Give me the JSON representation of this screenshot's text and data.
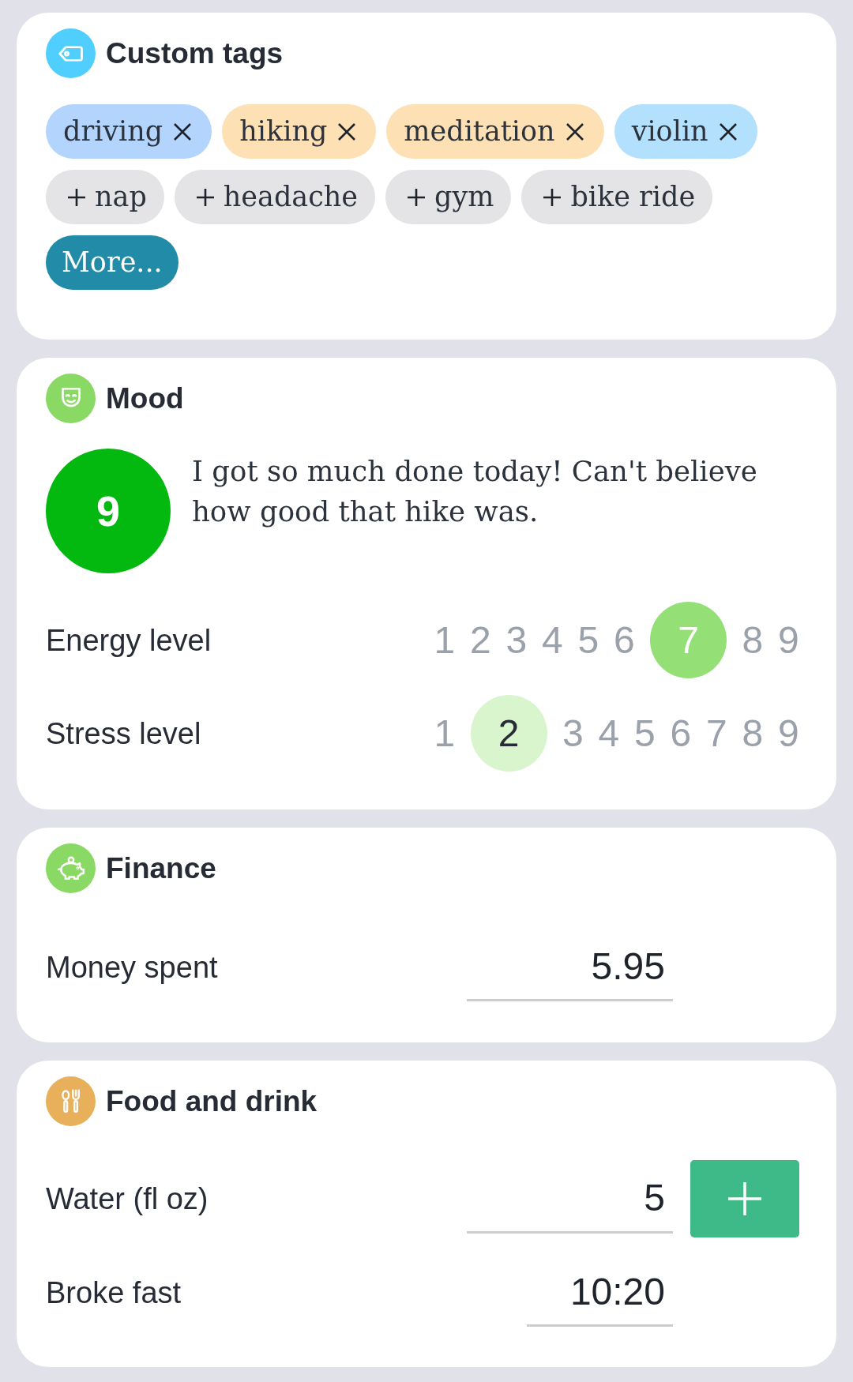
{
  "custom_tags": {
    "title": "Custom tags",
    "tags": [
      {
        "label": "driving",
        "selected": true,
        "color": "#b3d4fc"
      },
      {
        "label": "hiking",
        "selected": true,
        "color": "#fde0b4"
      },
      {
        "label": "meditation",
        "selected": true,
        "color": "#fde0b4"
      },
      {
        "label": "violin",
        "selected": true,
        "color": "#b3e0fc"
      },
      {
        "label": "nap",
        "selected": false
      },
      {
        "label": "headache",
        "selected": false
      },
      {
        "label": "gym",
        "selected": false
      },
      {
        "label": "bike ride",
        "selected": false
      }
    ],
    "more_button": "More..."
  },
  "mood": {
    "title": "Mood",
    "score": "9",
    "note": "I got so much done today! Can't believe how good that hike was.",
    "scales": [
      {
        "label": "Energy level",
        "color": "#95df77",
        "options": [
          {
            "label": "1",
            "selected": false
          },
          {
            "label": "2",
            "selected": false
          },
          {
            "label": "3",
            "selected": false
          },
          {
            "label": "4",
            "selected": false
          },
          {
            "label": "5",
            "selected": false
          },
          {
            "label": "6",
            "selected": false
          },
          {
            "label": "7",
            "selected": true
          },
          {
            "label": "8",
            "selected": false
          },
          {
            "label": "9",
            "selected": false
          }
        ]
      },
      {
        "label": "Stress level",
        "color": "#d9f5cd",
        "options": [
          {
            "label": "1",
            "selected": false
          },
          {
            "label": "2",
            "selected": true
          },
          {
            "label": "3",
            "selected": false
          },
          {
            "label": "4",
            "selected": false
          },
          {
            "label": "5",
            "selected": false
          },
          {
            "label": "6",
            "selected": false
          },
          {
            "label": "7",
            "selected": false
          },
          {
            "label": "8",
            "selected": false
          },
          {
            "label": "9",
            "selected": false
          }
        ]
      }
    ]
  },
  "finance": {
    "title": "Finance",
    "fields": [
      {
        "kind": "amount",
        "label": "Money spent",
        "value": "5.95"
      }
    ]
  },
  "food_and_drink": {
    "title": "Food and drink",
    "fields": [
      {
        "kind": "counter",
        "label": "Water (fl oz)",
        "value": "5"
      },
      {
        "kind": "time",
        "label": "Broke fast",
        "value": "10:20"
      }
    ]
  }
}
